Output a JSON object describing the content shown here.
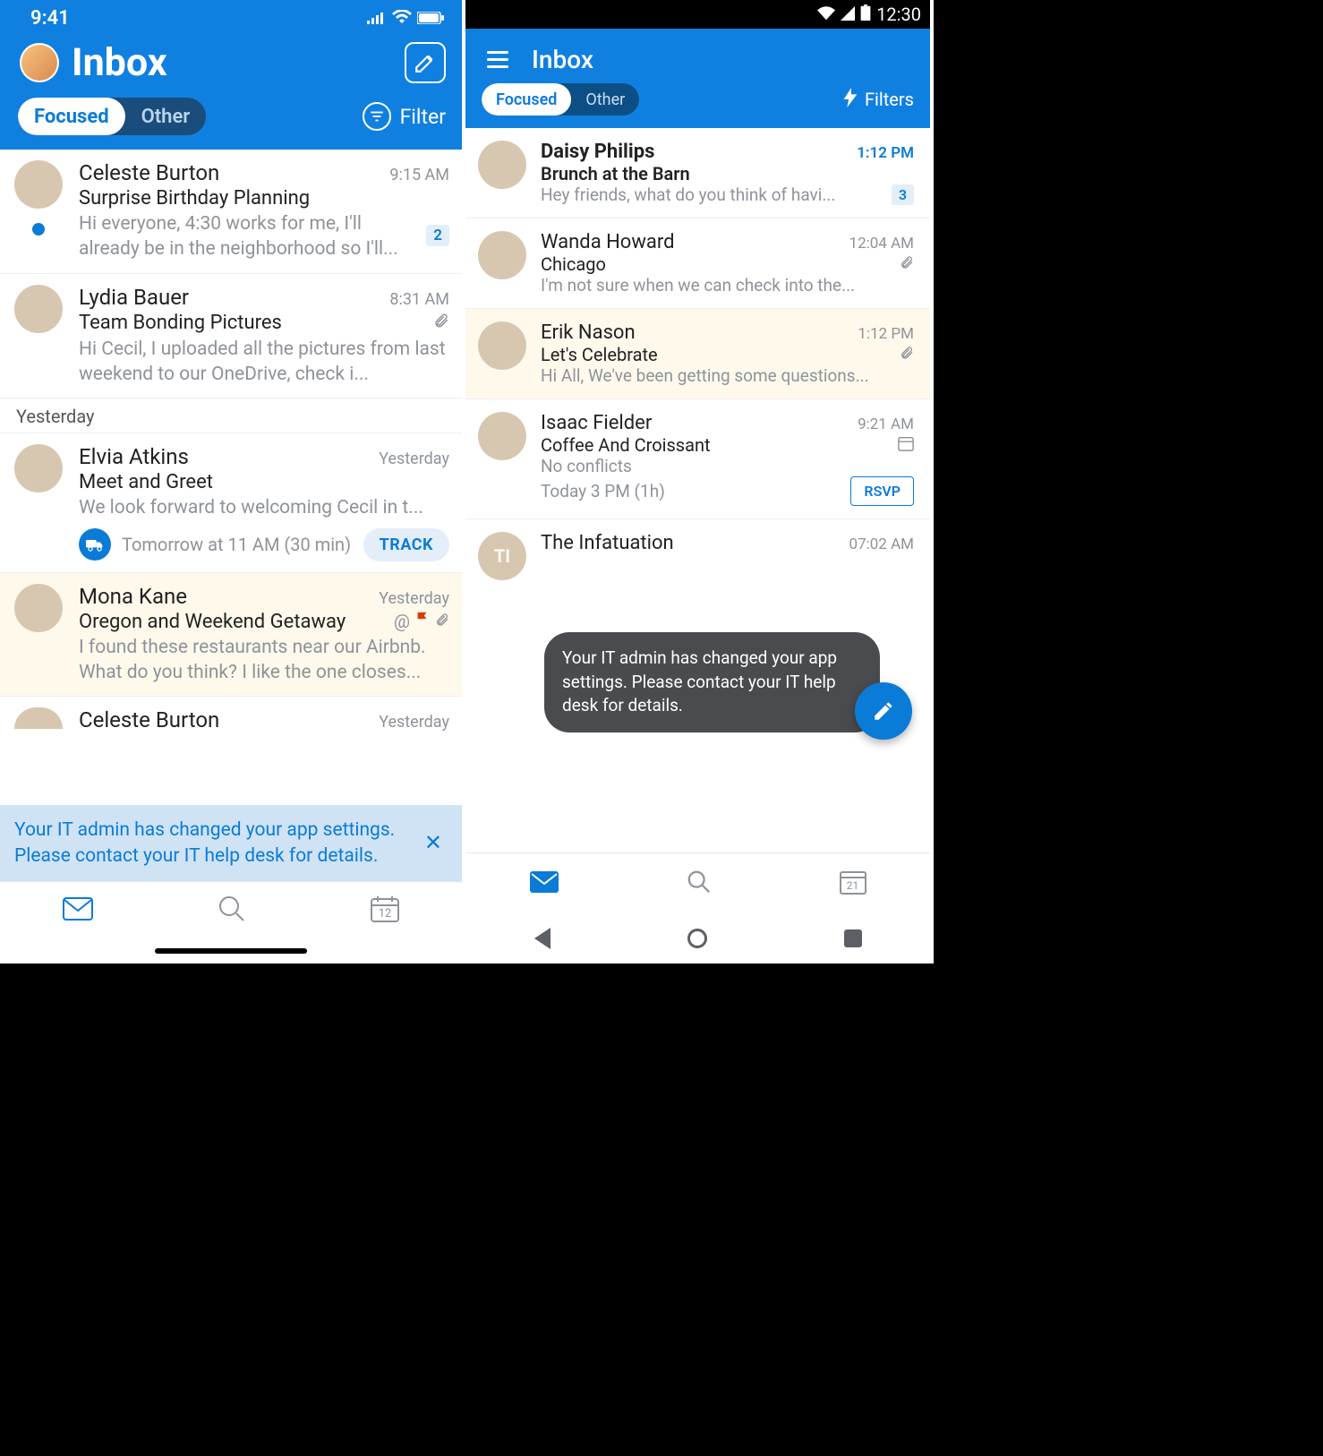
{
  "ios": {
    "status_time": "9:41",
    "title": "Inbox",
    "tabs": {
      "focused": "Focused",
      "other": "Other"
    },
    "filter_label": "Filter",
    "section_yesterday": "Yesterday",
    "messages": [
      {
        "sender": "Celeste Burton",
        "time": "9:15 AM",
        "subject": "Surprise Birthday Planning",
        "preview": "Hi everyone, 4:30 works for me, I'll already be in the neighborhood so I'll...",
        "badge": "2",
        "unread_dot": true
      },
      {
        "sender": "Lydia Bauer",
        "time": "8:31 AM",
        "subject": "Team Bonding Pictures",
        "preview": "Hi Cecil, I uploaded all the pictures from last weekend to our OneDrive, check i...",
        "attachment": true
      },
      {
        "sender": "Elvia Atkins",
        "time": "Yesterday",
        "subject": "Meet and Greet",
        "preview": "We look forward to welcoming Cecil in t...",
        "appt_text": "Tomorrow at 11 AM (30 min)",
        "track_label": "TRACK"
      },
      {
        "sender": "Mona Kane",
        "time": "Yesterday",
        "subject": "Oregon and Weekend Getaway",
        "preview": "I found these restaurants near our Airbnb. What do you think? I like the one closes...",
        "mention": true,
        "flag": true,
        "attachment": true,
        "highlight": true
      },
      {
        "sender": "Celeste Burton",
        "time": "Yesterday"
      }
    ],
    "banner": "Your IT admin has changed your app settings. Please contact your IT help desk for details.",
    "nav_cal_day": "12"
  },
  "android": {
    "status_time": "12:30",
    "title": "Inbox",
    "tabs": {
      "focused": "Focused",
      "other": "Other"
    },
    "filters_label": "Filters",
    "messages": [
      {
        "sender": "Daisy Philips",
        "time": "1:12 PM",
        "unread": true,
        "subject": "Brunch at the Barn",
        "preview": "Hey friends, what do you think of havi...",
        "badge": "3"
      },
      {
        "sender": "Wanda Howard",
        "time": "12:04 AM",
        "subject": "Chicago",
        "preview": "I'm not sure when we can check into the...",
        "attachment": true
      },
      {
        "sender": "Erik Nason",
        "time": "1:12 PM",
        "subject": "Let's Celebrate",
        "preview": "Hi All, We've been getting some questions...",
        "attachment": true,
        "highlight": true
      },
      {
        "sender": "Isaac Fielder",
        "time": "9:21 AM",
        "subject": "Coffee And Croissant",
        "preview": "No conflicts",
        "calendar": true,
        "appt_text": "Today 3 PM (1h)",
        "rsvp_label": "RSVP"
      },
      {
        "sender": "The Infatuation",
        "time": "07:02 AM",
        "avatar_initials": "TI"
      }
    ],
    "toast": "Your IT admin has changed your app settings. Please contact your IT help desk for details.",
    "nav_cal_day": "21"
  }
}
